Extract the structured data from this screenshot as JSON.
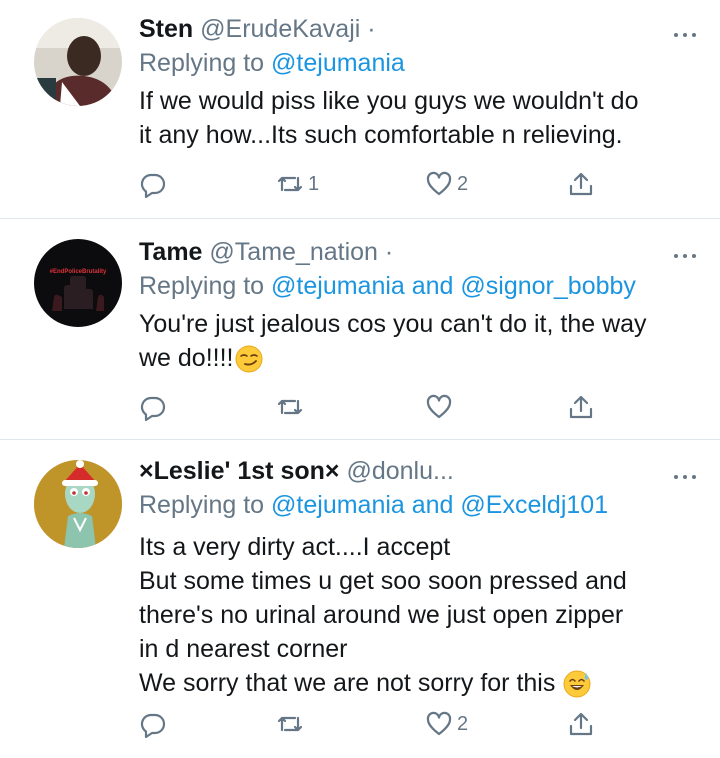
{
  "tweets": [
    {
      "name": "Sten",
      "handle": "@ErudeKavaji ·",
      "replying_label": "Replying to",
      "mentions": "@tejumania",
      "body_lines": [
        "If we would piss like you guys we wouldn't do",
        "it any how...Its such comfortable n relieving."
      ],
      "retweets": "1",
      "likes": "2"
    },
    {
      "name": "Tame",
      "handle": "@Tame_nation ·",
      "replying_label": "Replying to",
      "mentions": "@tejumania and @signor_bobby",
      "body_lines": [
        "You're just jealous cos you can't do it, the way",
        "we do!!!!"
      ],
      "avatar_text": "#EndPoliceBrutality",
      "retweets": "",
      "likes": ""
    },
    {
      "name": "×Leslie' 1st son×",
      "handle": "@donlu...",
      "replying_label": "Replying to",
      "mentions": "@tejumania and @Exceldj101",
      "body_lines": [
        "Its a very dirty act....I accept",
        "But some times u get soo soon pressed and",
        "there's no urinal around we just open zipper",
        "in d nearest corner",
        "We sorry that we are not sorry for this"
      ],
      "retweets": "",
      "likes": "2"
    }
  ],
  "icons": {
    "reply": "reply-icon",
    "retweet": "retweet-icon",
    "like": "heart-icon",
    "share": "share-icon",
    "more": "more-icon",
    "smirk": "smirk-emoji-icon",
    "sweat_smile": "sweat-smile-emoji-icon"
  },
  "colors": {
    "link": "#1b95e0",
    "secondary": "#657786",
    "text": "#14171a",
    "divider": "#e1e8ed"
  }
}
